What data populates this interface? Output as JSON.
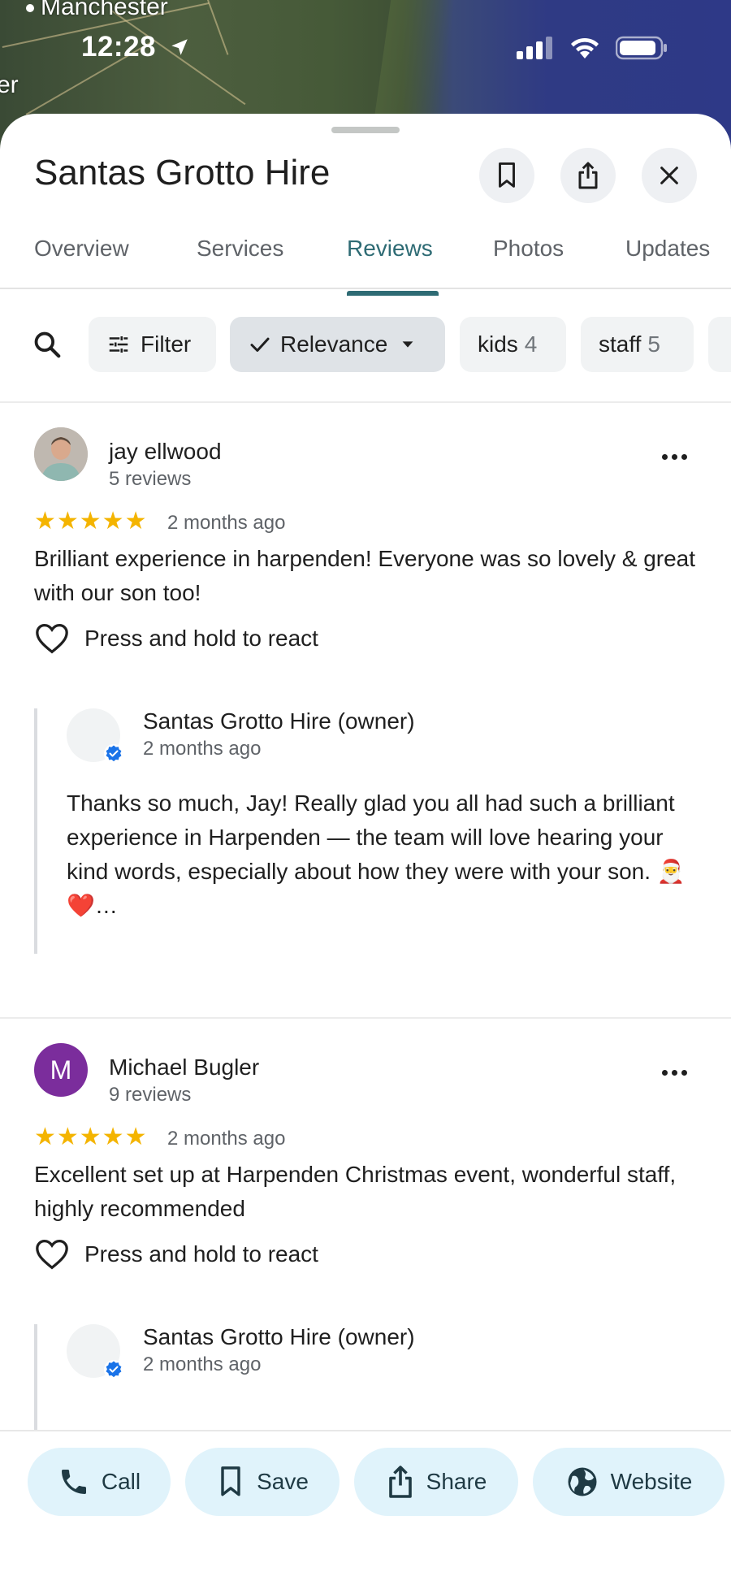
{
  "status_bar": {
    "time": "12:28"
  },
  "map": {
    "labels": [
      "Manchester",
      "er"
    ]
  },
  "place": {
    "title": "Santas Grotto Hire"
  },
  "header_actions": {
    "save_icon": "bookmark-icon",
    "share_icon": "share-icon",
    "close_icon": "close-icon"
  },
  "tabs": [
    {
      "label": "Overview"
    },
    {
      "label": "Services"
    },
    {
      "label": "Reviews",
      "active": true
    },
    {
      "label": "Photos"
    },
    {
      "label": "Updates"
    }
  ],
  "filters": {
    "search_icon": "search-icon",
    "filter_label": "Filter",
    "sort_label": "Relevance",
    "topics": [
      {
        "label": "kids",
        "count": "4"
      },
      {
        "label": "staff",
        "count": "5"
      }
    ]
  },
  "reviews": [
    {
      "author": "jay ellwood",
      "meta": "5 reviews",
      "rating": 5,
      "stars": "★★★★★",
      "date": "2 months ago",
      "text": "Brilliant experience in harpenden! Everyone was so lovely & great with our son too!",
      "react_label": "Press and hold to react",
      "owner": {
        "name": "Santas Grotto Hire (owner)",
        "date": "2 months ago",
        "text": "Thanks so much, Jay! Really glad you all had such a brilliant experience in Harpenden — the team will love hearing your kind words, especially about how they were with your son. 🎅❤️…"
      }
    },
    {
      "author": "Michael Bugler",
      "initial": "M",
      "meta": "9 reviews",
      "rating": 5,
      "stars": "★★★★★",
      "date": "2 months ago",
      "text": "Excellent set up at Harpenden Christmas event, wonderful staff, highly recommended",
      "react_label": "Press and hold to react",
      "owner": {
        "name": "Santas Grotto Hire (owner)",
        "date": "2 months ago"
      }
    }
  ],
  "actions": {
    "call": "Call",
    "save": "Save",
    "share": "Share",
    "website": "Website"
  },
  "colors": {
    "accent": "#2e6b74",
    "star": "#f4b400",
    "action_bg": "#e0f3fb",
    "avatar_purple": "#7b2d9c",
    "verified_blue": "#1a73e8"
  }
}
